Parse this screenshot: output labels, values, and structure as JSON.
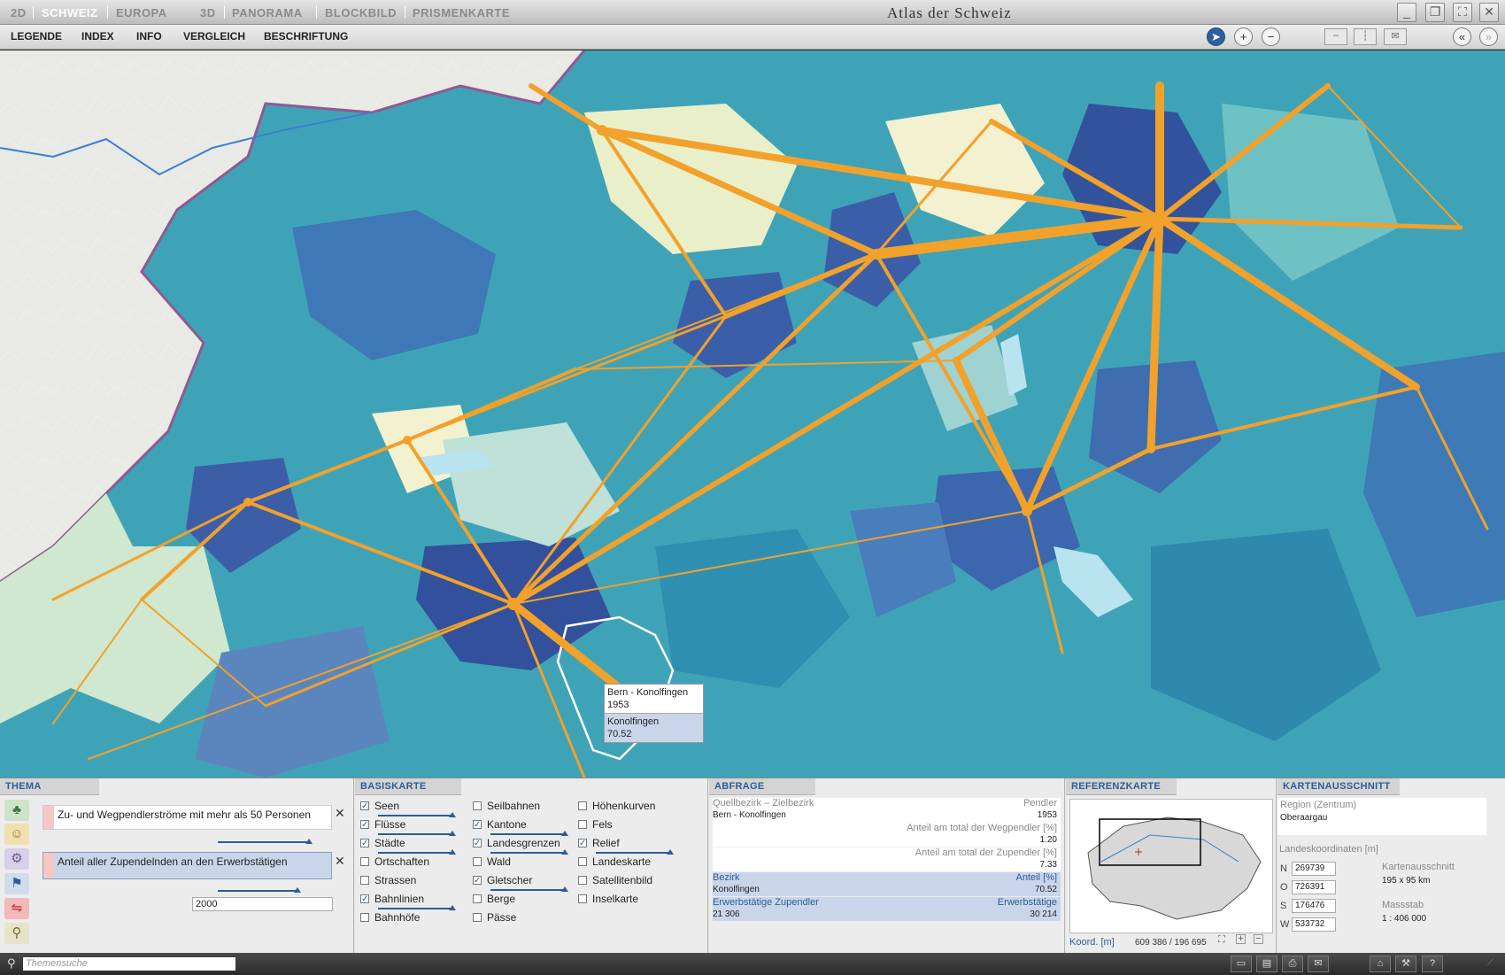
{
  "titlebar": {
    "tabs": [
      "2D",
      "SCHWEIZ",
      "EUROPA",
      "3D",
      "PANORAMA",
      "BLOCKBILD",
      "PRISMENKARTE"
    ],
    "app_title": "Atlas der Schweiz"
  },
  "menu": [
    "LEGENDE",
    "INDEX",
    "INFO",
    "VERGLEICH",
    "BESCHRIFTUNG"
  ],
  "map": {
    "tooltip": {
      "route": "Bern - Konolfingen",
      "route_value": "1953",
      "district": "Konolfingen",
      "district_value": "70.52"
    }
  },
  "thema": {
    "title": "THEMA",
    "items": [
      "Zu- und Wegpendlerströme mit mehr als 50 Personen",
      "Anteil aller Zupendelnden an den Erwerbstätigen"
    ],
    "year": "2000"
  },
  "basiskarte": {
    "title": "BASISKARTE",
    "col1": [
      {
        "label": "Seen",
        "checked": true
      },
      {
        "label": "Flüsse",
        "checked": true
      },
      {
        "label": "Städte",
        "checked": true
      },
      {
        "label": "Ortschaften",
        "checked": false
      },
      {
        "label": "Strassen",
        "checked": false
      },
      {
        "label": "Bahnlinien",
        "checked": true
      },
      {
        "label": "Bahnhöfe",
        "checked": false
      }
    ],
    "col2": [
      {
        "label": "Seilbahnen",
        "checked": false
      },
      {
        "label": "Kantone",
        "checked": true
      },
      {
        "label": "Landesgrenzen",
        "checked": true
      },
      {
        "label": "Wald",
        "checked": false
      },
      {
        "label": "Gletscher",
        "checked": true
      },
      {
        "label": "Berge",
        "checked": false
      },
      {
        "label": "Pässe",
        "checked": false
      }
    ],
    "col3": [
      {
        "label": "Höhenkurven",
        "checked": false
      },
      {
        "label": "Fels",
        "checked": false
      },
      {
        "label": "Relief",
        "checked": true
      },
      {
        "label": "Landeskarte",
        "checked": false
      },
      {
        "label": "Satellitenbild",
        "checked": false
      },
      {
        "label": "Inselkarte",
        "checked": false
      }
    ]
  },
  "abfrage": {
    "title": "ABFRAGE",
    "h1_left": "Quellbezirk – Zielbezirk",
    "h1_right": "Pendler",
    "v1_left": "Bern - Konolfingen",
    "v1_right": "1953",
    "h2_right": "Anteil am total der Wegpendler [%]",
    "v2_right": "1.20",
    "h3_right": "Anteil am total der Zupendler [%]",
    "v3_right": "7.33",
    "h4_left": "Bezirk",
    "h4_right": "Anteil [%]",
    "v4_left": "Konolfingen",
    "v4_right": "70.52",
    "h5_left": "Erwerbstätige Zupendler",
    "h5_right": "Erwerbstätige",
    "v5_left": "21 306",
    "v5_right": "30 214"
  },
  "referenzkarte": {
    "title": "REFERENZKARTE",
    "koord_label": "Koord. [m]",
    "koord_value": "609 386 / 196 695"
  },
  "kartenausschnitt": {
    "title": "KARTENAUSSCHNITT",
    "region_label": "Region (Zentrum)",
    "region_value": "Oberaargau",
    "coords_label": "Landeskoordinaten [m]",
    "N": "269739",
    "O": "726391",
    "S": "176476",
    "W": "533732",
    "extent_label": "Kartenausschnitt",
    "extent_value": "195 x 95 km",
    "scale_label": "Massstab",
    "scale_value": "1 : 406 000"
  },
  "status": {
    "search_placeholder": "Themensuche"
  }
}
